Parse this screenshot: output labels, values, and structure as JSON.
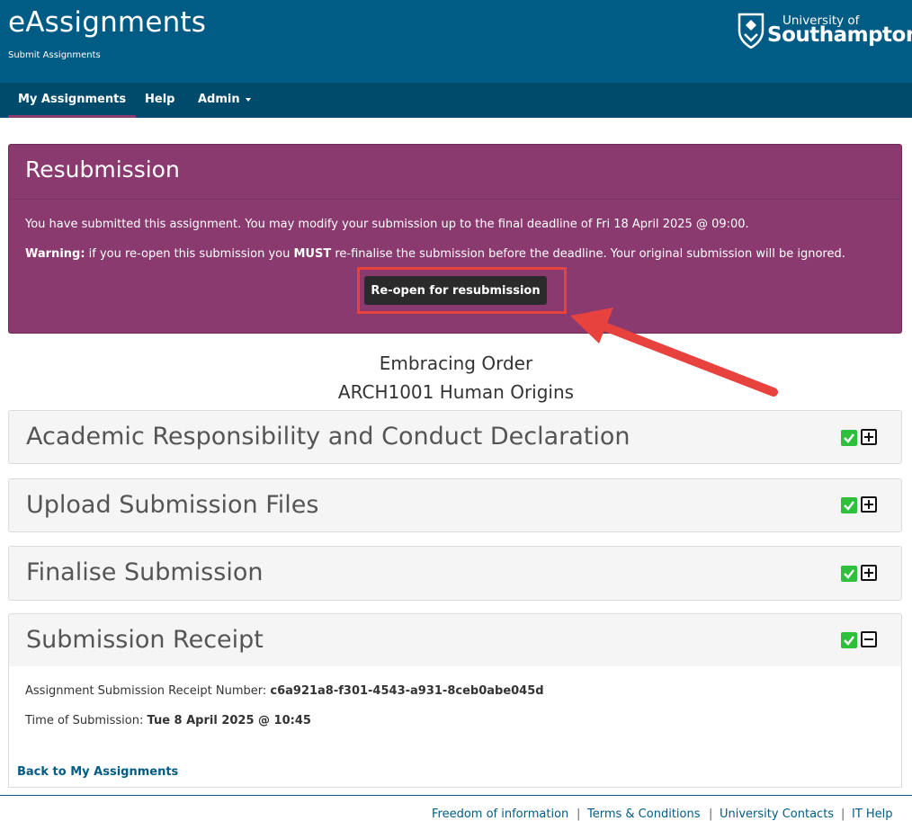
{
  "header": {
    "title": "eAssignments",
    "subtitle": "Submit Assignments",
    "logo": {
      "line1": "University of",
      "line2": "Southampton"
    }
  },
  "nav": {
    "items": [
      {
        "label": "My Assignments",
        "active": true
      },
      {
        "label": "Help"
      },
      {
        "label": "Admin"
      }
    ]
  },
  "resubmission": {
    "title": "Resubmission",
    "info": "You have submitted this assignment. You may modify your submission up to the final deadline of Fri 18 April 2025 @ 09:00.",
    "warning_label": "Warning:",
    "warning_pre": " if you re-open this submission you ",
    "warning_must": "MUST",
    "warning_post": " re-finalise the submission before the deadline. Your original submission will be ignored.",
    "button_label": "Re-open for resubmission"
  },
  "assignment": {
    "title": "Embracing Order",
    "module": "ARCH1001 Human Origins"
  },
  "sections": [
    {
      "title": "Academic Responsibility and Conduct Declaration",
      "completed": true,
      "expanded": false
    },
    {
      "title": "Upload Submission Files",
      "completed": true,
      "expanded": false
    },
    {
      "title": "Finalise Submission",
      "completed": true,
      "expanded": false
    },
    {
      "title": "Submission Receipt",
      "completed": true,
      "expanded": true
    }
  ],
  "receipt": {
    "number_label": "Assignment Submission Receipt Number: ",
    "number_value": "c6a921a8-f301-4543-a931-8ceb0abe045d",
    "time_label": "Time of Submission: ",
    "time_value": "Tue 8 April 2025 @ 10:45",
    "back_link": "Back to My Assignments"
  },
  "footer": {
    "links": [
      "Freedom of information",
      "Terms & Conditions",
      "University Contacts",
      "IT Help"
    ]
  },
  "colors": {
    "header_bg": "#005c84",
    "nav_bg": "#004b6c",
    "resubmission_bg": "#8a3a6f",
    "check_green": "#2ec03d",
    "annotation_red": "#e8423f",
    "link_blue": "#005c84"
  },
  "icons": {
    "completed": "check-icon",
    "collapsed": "plus-square-icon",
    "expanded": "minus-square-icon",
    "annotation": "arrow-icon"
  }
}
